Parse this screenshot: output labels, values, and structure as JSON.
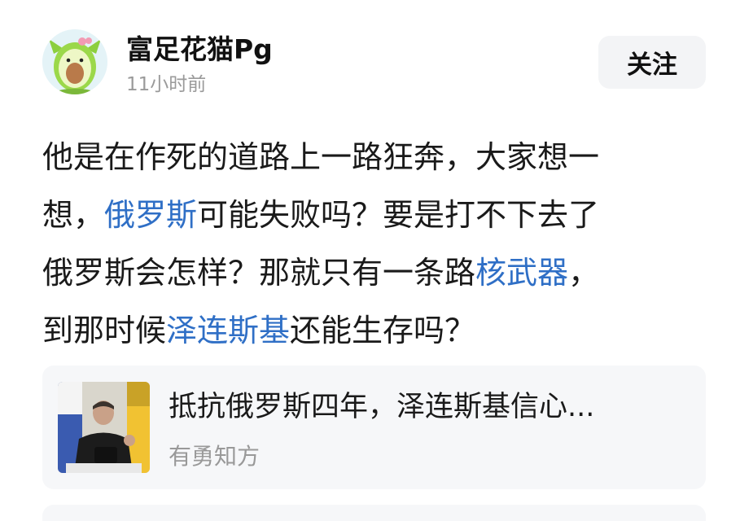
{
  "author": {
    "name": "富足花猫Pg",
    "time": "11小时前",
    "avatar_icon": "avocado-avatar-icon"
  },
  "follow_button": {
    "label": "关注"
  },
  "post": {
    "lines": [
      [
        {
          "text": "他是在作死的道路上一路狂奔，大家想一",
          "link": false
        }
      ],
      [
        {
          "text": "想，",
          "link": false
        },
        {
          "text": "俄罗斯",
          "link": true
        },
        {
          "text": "可能失败吗？要是打不下去了",
          "link": false
        }
      ],
      [
        {
          "text": "俄罗斯会怎样？那就只有一条路",
          "link": false
        },
        {
          "text": "核武器",
          "link": true
        },
        {
          "text": "，",
          "link": false
        }
      ],
      [
        {
          "text": "到那时候",
          "link": false
        },
        {
          "text": "泽连斯基",
          "link": true
        },
        {
          "text": "还能生存吗？",
          "link": false
        }
      ]
    ]
  },
  "news_card": {
    "title": "抵抗俄罗斯四年，泽连斯基信心...",
    "source": "有勇知方",
    "thumbnail_icon": "news-thumbnail-image"
  },
  "colors": {
    "link": "#2f6fc6",
    "secondary_text": "#9a9a9a",
    "card_bg": "#f6f7f9",
    "button_bg": "#f3f4f6"
  }
}
